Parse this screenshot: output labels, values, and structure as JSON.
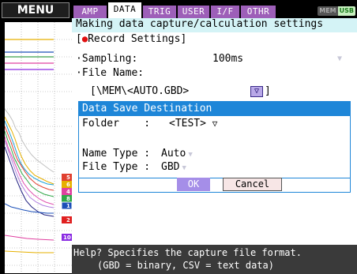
{
  "menu": {
    "label": "MENU"
  },
  "tabs": [
    {
      "label": "AMP",
      "active": false
    },
    {
      "label": "DATA",
      "active": true
    },
    {
      "label": "TRIG",
      "active": false
    },
    {
      "label": "USER",
      "active": false
    },
    {
      "label": "I/F",
      "active": false
    },
    {
      "label": "OTHR",
      "active": false
    }
  ],
  "status": {
    "mem": "MEM",
    "usb": "USB"
  },
  "settings": {
    "title": "Making data capture/calculation settings",
    "record_section": "Record Settings]",
    "record_prefix": "[",
    "sampling_label": "·Sampling:",
    "sampling_value": "100ms",
    "file_name_label": "·File Name:",
    "file_name_value": "[\\MEM\\<AUTO.GBD>",
    "file_name_suffix": "]"
  },
  "dialog": {
    "title": "Data Save Destination",
    "folder_label": "Folder    :",
    "folder_value": "<TEST>",
    "name_type_label": "Name Type :",
    "name_type_value": "Auto",
    "file_type_label": "File Type :",
    "file_type_value": "GBD",
    "ok_label": "OK",
    "cancel_label": "Cancel"
  },
  "help": {
    "line1": "Help? Specifies the capture file format.",
    "line2": "(GBD = binary, CSV = text data)"
  },
  "channel_markers": [
    "5",
    "6",
    "4",
    "8",
    "1",
    "2",
    "10"
  ],
  "colors": {
    "tab_inactive": "#9d5fb8",
    "dialog_accent": "#1e86d8",
    "title_bg": "#d4f3f6",
    "ok_button": "#a58ee8",
    "help_bg": "#3a3a3a",
    "record_dot": "#e01010"
  }
}
